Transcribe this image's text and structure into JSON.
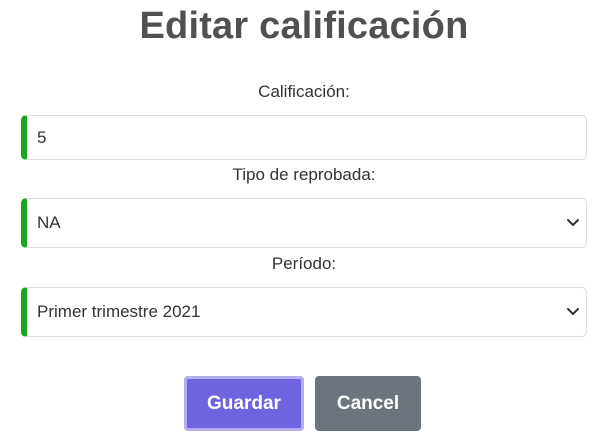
{
  "title": "Editar calificación",
  "fields": {
    "grade": {
      "label": "Calificación:",
      "value": "5"
    },
    "fail_type": {
      "label": "Tipo de reprobada:",
      "value": "NA"
    },
    "period": {
      "label": "Período:",
      "value": "Primer trimestre 2021"
    }
  },
  "buttons": {
    "save": "Guardar",
    "cancel": "Cancel"
  },
  "colors": {
    "field_accent": "#19a519",
    "save_button": "#6f63e0",
    "cancel_button": "#6c757d"
  },
  "icons": {
    "select_arrow": "chevron-down-icon"
  }
}
